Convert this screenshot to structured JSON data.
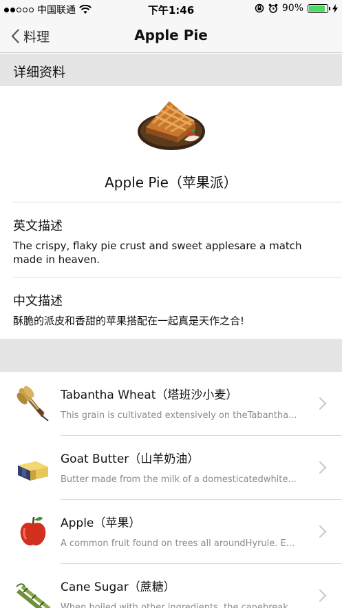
{
  "status_bar": {
    "carrier": "中国联通",
    "time": "下午1:46",
    "battery_percent": "90%",
    "battery_level": 0.9,
    "signal_bars_filled": 2,
    "signal_bars_total": 5,
    "icons": [
      "wifi-icon",
      "rotation-lock-icon",
      "alarm-icon",
      "battery-icon",
      "charging-icon"
    ]
  },
  "nav": {
    "back_label": "料理",
    "title": "Apple Pie"
  },
  "section": {
    "header": "详细资料"
  },
  "dish": {
    "name": "Apple Pie（苹果派）",
    "image": "apple-pie-image"
  },
  "english": {
    "title": "英文描述",
    "text": "The crispy, flaky pie crust and sweet applesare a match made in heaven."
  },
  "chinese": {
    "title": "中文描述",
    "text": "酥脆的派皮和香甜的苹果搭配在一起真是天作之合!"
  },
  "ingredients": [
    {
      "name": "Tabantha Wheat（塔班沙小麦）",
      "desc": "This grain is cultivated extensively on theTabantha...",
      "icon": "wheat-icon"
    },
    {
      "name": "Goat Butter（山羊奶油）",
      "desc": "Butter made from the milk of a domesticatedwhite...",
      "icon": "butter-icon"
    },
    {
      "name": "Apple（苹果）",
      "desc": "A common fruit found on trees all aroundHyrule. E...",
      "icon": "apple-icon"
    },
    {
      "name": "Cane Sugar（蔗糖）",
      "desc": "When boiled with other ingredients, the canebreak...",
      "icon": "cane-sugar-icon"
    }
  ],
  "colors": {
    "bar_background": "#f7f7f7",
    "section_gray": "#e5e5e5",
    "battery_green": "#4cd964",
    "secondary_text": "#8a8a8a",
    "chevron": "#c7c7cc"
  }
}
